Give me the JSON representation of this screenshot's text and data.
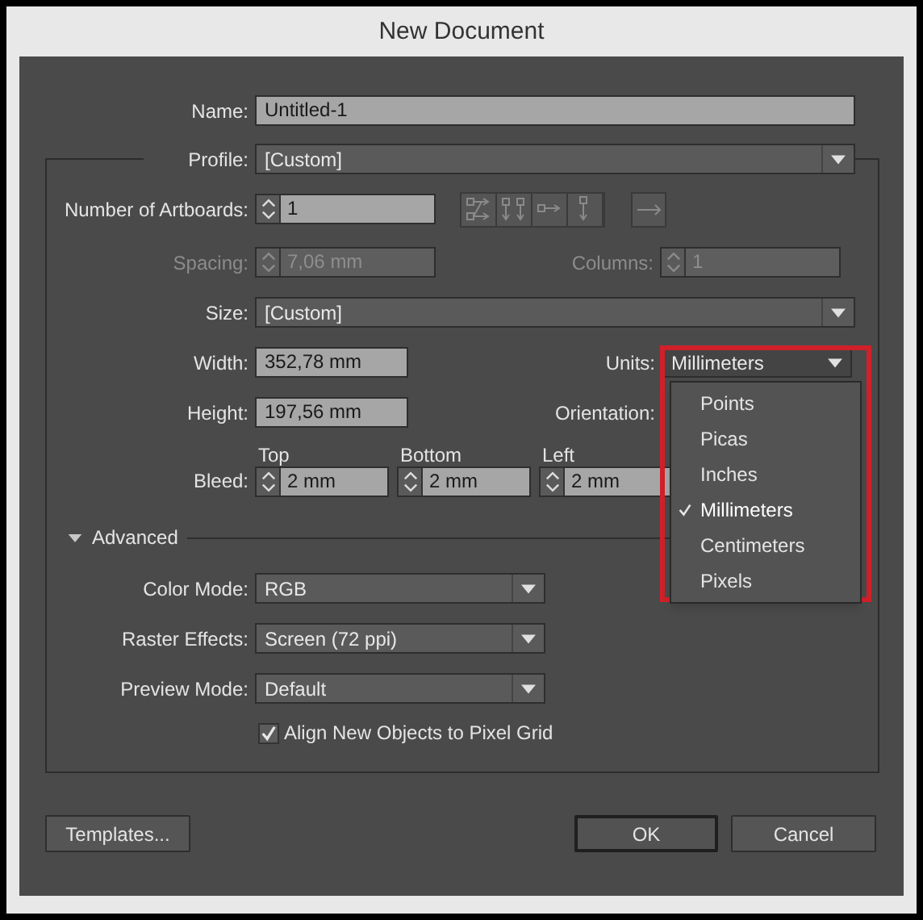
{
  "window": {
    "title": "New Document"
  },
  "name": {
    "label": "Name:",
    "value": "Untitled-1"
  },
  "profile": {
    "label": "Profile:",
    "value": "[Custom]"
  },
  "artboards": {
    "label": "Number of Artboards:",
    "value": "1",
    "disabled": false
  },
  "spacing": {
    "label": "Spacing:",
    "value": "7,06 mm",
    "disabled": true
  },
  "columns": {
    "label": "Columns:",
    "value": "1",
    "disabled": true
  },
  "size": {
    "label": "Size:",
    "value": "[Custom]"
  },
  "width": {
    "label": "Width:",
    "value": "352,78 mm"
  },
  "height": {
    "label": "Height:",
    "value": "197,56 mm"
  },
  "units": {
    "label": "Units:",
    "value": "Millimeters",
    "expanded": true,
    "options": [
      {
        "label": "Points",
        "selected": false
      },
      {
        "label": "Picas",
        "selected": false
      },
      {
        "label": "Inches",
        "selected": false
      },
      {
        "label": "Millimeters",
        "selected": true
      },
      {
        "label": "Centimeters",
        "selected": false
      },
      {
        "label": "Pixels",
        "selected": false
      }
    ]
  },
  "orientation": {
    "label": "Orientation:"
  },
  "bleed": {
    "label": "Bleed:",
    "fields": [
      {
        "label": "Top",
        "value": "2 mm"
      },
      {
        "label": "Bottom",
        "value": "2 mm"
      },
      {
        "label": "Left",
        "value": "2 mm"
      }
    ]
  },
  "advanced": {
    "label": "Advanced",
    "expanded": true
  },
  "advanced_fields": [
    {
      "label": "Color Mode:",
      "value": "RGB"
    },
    {
      "label": "Raster Effects:",
      "value": "Screen (72 ppi)"
    },
    {
      "label": "Preview Mode:",
      "value": "Default"
    }
  ],
  "align_to_pixel_grid": {
    "label": "Align New Objects to Pixel Grid",
    "checked": true
  },
  "buttons": [
    {
      "label": "Templates...",
      "kind": "secondary"
    },
    {
      "label": "OK",
      "kind": "default"
    },
    {
      "label": "Cancel",
      "kind": "secondary"
    }
  ]
}
